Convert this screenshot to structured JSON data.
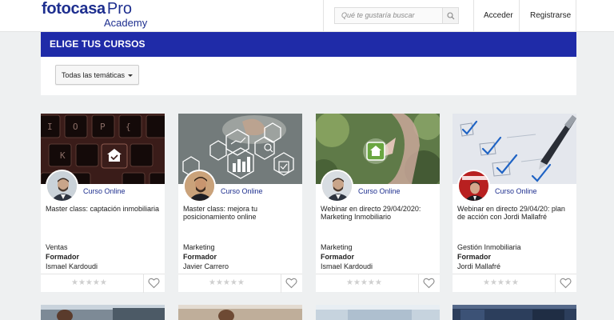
{
  "header": {
    "logo_main": "fotocasa",
    "logo_pro": "Pro",
    "logo_sub": "Academy",
    "search_placeholder": "Qué te gustaría buscar",
    "login": "Acceder",
    "register": "Registrarse"
  },
  "banner": {
    "title": "ELIGE TUS CURSOS"
  },
  "filter": {
    "selected": "Todas las temáticas"
  },
  "card_common": {
    "online_label": "Curso Online",
    "role_label": "Formador",
    "stars": "★★★★★"
  },
  "cards": [
    {
      "title": "Master class: captación inmobiliaria",
      "topic": "Ventas",
      "trainer": "Ismael Kardoudi",
      "rating": 0
    },
    {
      "title": "Master class: mejora tu posicionamiento online",
      "topic": "Marketing",
      "trainer": "Javier Carrero",
      "rating": 0
    },
    {
      "title": "Webinar en directo 29/04/2020: Marketing Inmobiliario",
      "topic": "Marketing",
      "trainer": "Ismael Kardoudi",
      "rating": 0
    },
    {
      "title": "Webinar en directo 29/04/20: plan de acción con Jordi Mallafré",
      "topic": "Gestión Inmobiliaria",
      "trainer": "Jordi Mallafré",
      "rating": 0
    }
  ],
  "colors": {
    "brand": "#1e2f8f",
    "banner": "#1f2ba8",
    "background": "#eef0f1"
  }
}
